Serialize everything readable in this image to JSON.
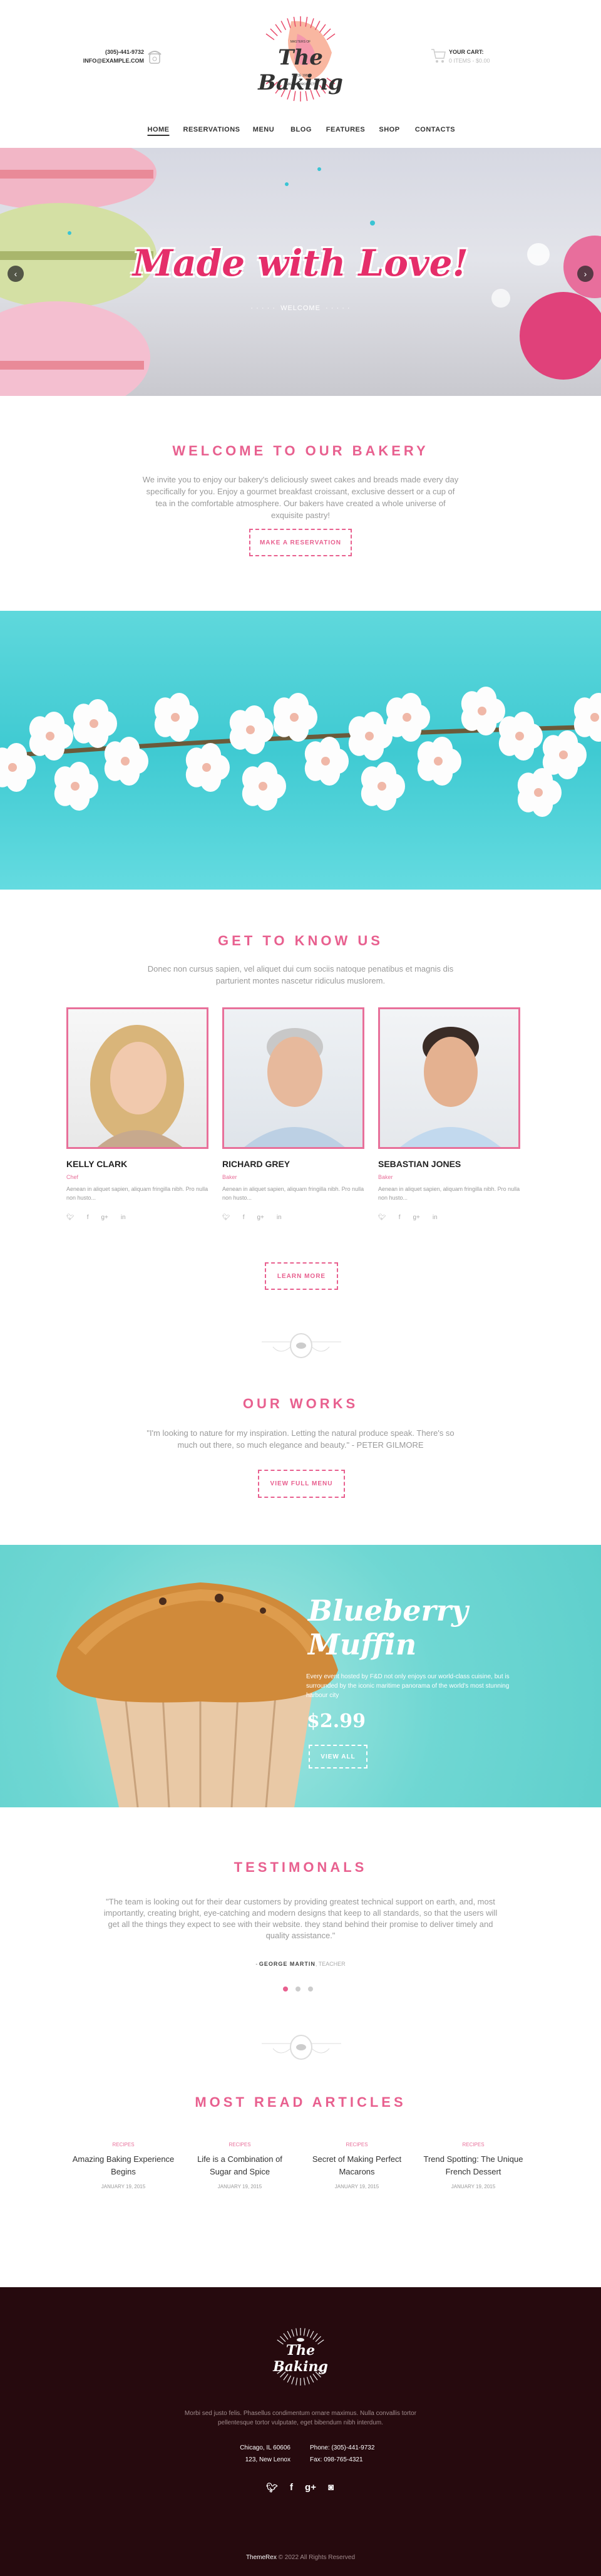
{
  "header": {
    "phone": "(305)-441-9732",
    "email": "INFO@EXAMPLE.COM",
    "logo": {
      "top": "MASTERS OF",
      "name": "The Baking",
      "since": "SINCE 1983",
      "tagline": "AMAZING PRODUCTS"
    },
    "cart_title": "YOUR CART:",
    "cart_summary": "0 ITEMS - $0.00"
  },
  "nav": {
    "items": [
      {
        "label": "HOME",
        "active": true
      },
      {
        "label": "RESERVATIONS"
      },
      {
        "label": "MENU"
      },
      {
        "label": "BLOG"
      },
      {
        "label": "FEATURES"
      },
      {
        "label": "SHOP"
      },
      {
        "label": "CONTACTS"
      }
    ]
  },
  "hero": {
    "title": "Made with Love!",
    "subtitle": "WELCOME"
  },
  "welcome": {
    "title": "WELCOME TO OUR BAKERY",
    "text": "We invite you to enjoy our bakery's deliciously sweet cakes and breads made every day specifically for you. Enjoy a gourmet breakfast croissant, exclusive dessert or a cup of tea in the comfortable atmosphere. Our bakers have created a whole universe of exquisite pastry!",
    "button": "MAKE A RESERVATION"
  },
  "team": {
    "title": "GET TO KNOW US",
    "text": "Donec non cursus sapien, vel aliquet dui cum sociis natoque penatibus et magnis dis parturient montes nascetur ridiculus muslorem.",
    "members": [
      {
        "name": "KELLY CLARK",
        "role": "Chef",
        "bio": "Aenean in aliquet sapien, aliquam fringilla nibh. Pro nulla non husto..."
      },
      {
        "name": "RICHARD GREY",
        "role": "Baker",
        "bio": "Aenean in aliquet sapien, aliquam fringilla nibh. Pro nulla non husto..."
      },
      {
        "name": "SEBASTIAN JONES",
        "role": "Baker",
        "bio": "Aenean in aliquet sapien, aliquam fringilla nibh. Pro nulla non husto..."
      }
    ],
    "social_icons": [
      "twitter-icon",
      "facebook-icon",
      "google-plus-icon",
      "linkedin-icon"
    ],
    "button": "LEARN MORE"
  },
  "works": {
    "title": "OUR WORKS",
    "quote": "\"I'm looking to nature for my inspiration. Letting the natural produce speak. There's so much out there, so much elegance and beauty.\" - PETER GILMORE",
    "button": "VIEW FULL MENU"
  },
  "promo": {
    "title_line1": "Blueberry",
    "title_line2": "Muffin",
    "text": "Every event hosted by F&D not only enjoys our world-class cuisine, but is surrounded by the iconic maritime panorama of the world's most stunning harbour city",
    "price": "$2.99",
    "button": "VIEW ALL"
  },
  "testimonials": {
    "title": "TESTIMONALS",
    "quote": "\"The team is looking out for their dear customers by providing greatest technical support on earth, and, most importantly, creating bright, eye-catching and modern designs that keep to all standards, so that the users will get all the things they expect to see with their website. they stand behind their promise to deliver timely and quality assistance.\"",
    "author": "GEORGE MARTIN",
    "author_role": ", TEACHER",
    "active_dot": 1,
    "dot_count": 3
  },
  "articles": {
    "title": "MOST READ ARTICLES",
    "items": [
      {
        "category": "RECIPES",
        "title": "Amazing Baking Experience Begins",
        "date": "JANUARY 19, 2015"
      },
      {
        "category": "RECIPES",
        "title": "Life is a Combination of Sugar and Spice",
        "date": "JANUARY 19, 2015"
      },
      {
        "category": "RECIPES",
        "title": "Secret of Making Perfect Macarons",
        "date": "JANUARY 19, 2015"
      },
      {
        "category": "RECIPES",
        "title": "Trend Spotting: The Unique French Dessert",
        "date": "JANUARY 19, 2015"
      }
    ]
  },
  "footer": {
    "text": "Morbi sed justo felis. Phasellus condimentum ornare maximus. Nulla convallis tortor pellentesque tortor vulputate, eget bibendum nibh interdum.",
    "address_line1": "Chicago, IL 60606",
    "address_line2": "123, New Lenox",
    "phone": "Phone: (305)-441-9732",
    "fax": "Fax: 098-765-4321",
    "social_icons": [
      "twitter-icon",
      "facebook-icon",
      "google-plus-icon",
      "instagram-icon"
    ],
    "brand": "ThemeRex",
    "copyright": " © 2022 All Rights Reserved"
  },
  "colors": {
    "accent": "#e8608f",
    "footer_bg": "#260a0e",
    "turquoise": "#4fd6d6"
  }
}
